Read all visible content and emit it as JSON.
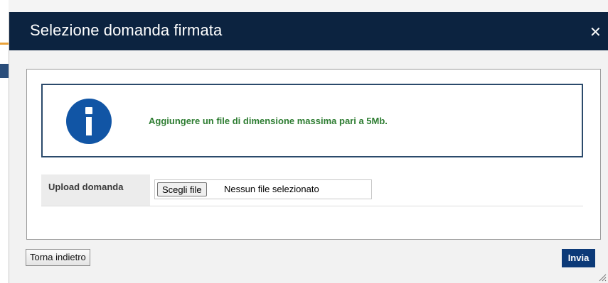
{
  "dialog": {
    "title": "Selezione domanda firmata",
    "close_icon": "close-icon"
  },
  "info": {
    "icon": "info-icon",
    "message": "Aggiungere un file di dimensione massima pari a 5Mb."
  },
  "upload": {
    "label": "Upload domanda",
    "choose_button": "Scegli file",
    "status": "Nessun file selezionato"
  },
  "actions": {
    "back_label": "Torna indietro",
    "send_label": "Invia"
  },
  "colors": {
    "titlebar": "#0c2340",
    "info_icon": "#1155a5",
    "info_text": "#2e7d32",
    "send_button": "#0c3a78"
  }
}
